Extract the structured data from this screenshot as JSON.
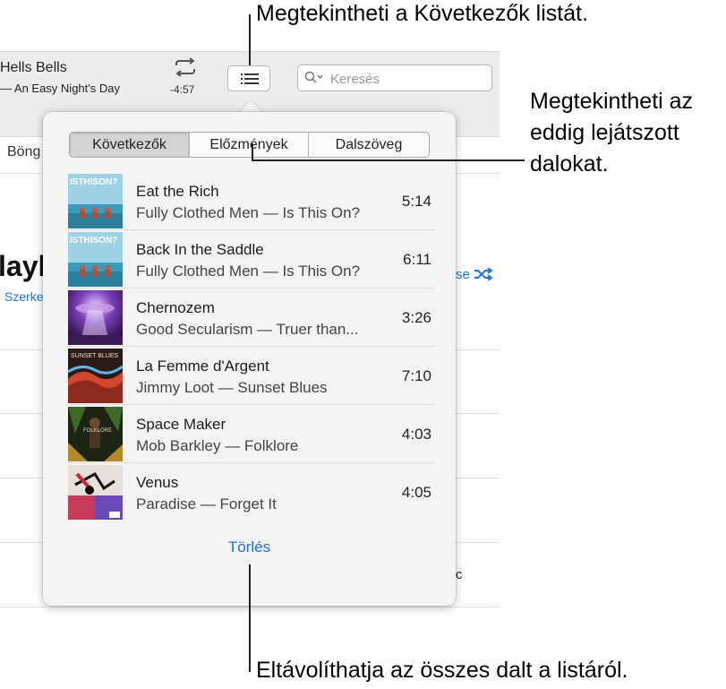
{
  "toolbar": {
    "now_playing_title": "Hells Bells",
    "now_playing_subtitle": "— An Easy Night's Day",
    "remaining_time": "-4:57",
    "search_placeholder": "Keresés"
  },
  "background": {
    "tab_label": "Böng",
    "heading_fragment": "layli",
    "edit_fragment": "Szerke",
    "shuffle_fragment": "se",
    "ghost_text": "c"
  },
  "popover": {
    "tabs": [
      {
        "label": "Következők",
        "active": true
      },
      {
        "label": "Előzmények",
        "active": false
      },
      {
        "label": "Dalszöveg",
        "active": false
      }
    ],
    "tracks": [
      {
        "title": "Eat the Rich",
        "subtitle": "Fully Clothed Men — Is This On?",
        "duration": "5:14",
        "art_text": "ISTHISON?"
      },
      {
        "title": "Back In the Saddle",
        "subtitle": "Fully Clothed Men — Is This On?",
        "duration": "6:11",
        "art_text": "ISTHISON?"
      },
      {
        "title": "Chernozem",
        "subtitle": "Good Secularism — Truer than...",
        "duration": "3:26",
        "art_text": ""
      },
      {
        "title": "La Femme d'Argent",
        "subtitle": "Jimmy Loot — Sunset Blues",
        "duration": "7:10",
        "art_text": "SUNSET BLUES"
      },
      {
        "title": "Space Maker",
        "subtitle": "Mob Barkley — Folklore",
        "duration": "4:03",
        "art_text": "FOLKLORE"
      },
      {
        "title": "Venus",
        "subtitle": "Paradise — Forget It",
        "duration": "4:05",
        "art_text": ""
      }
    ],
    "clear_label": "Törlés"
  },
  "callouts": {
    "up_next": "Megtekintheti a Következők listát.",
    "history": [
      "Megtekintheti az",
      "eddig lejátszott",
      "dalokat."
    ],
    "clear": "Eltávolíthatja az összes dalt a listáról."
  },
  "colors": {
    "accent": "#1a6fe0",
    "popover_bg": "#f4f4f4",
    "toolbar_bg": "#ececec"
  }
}
